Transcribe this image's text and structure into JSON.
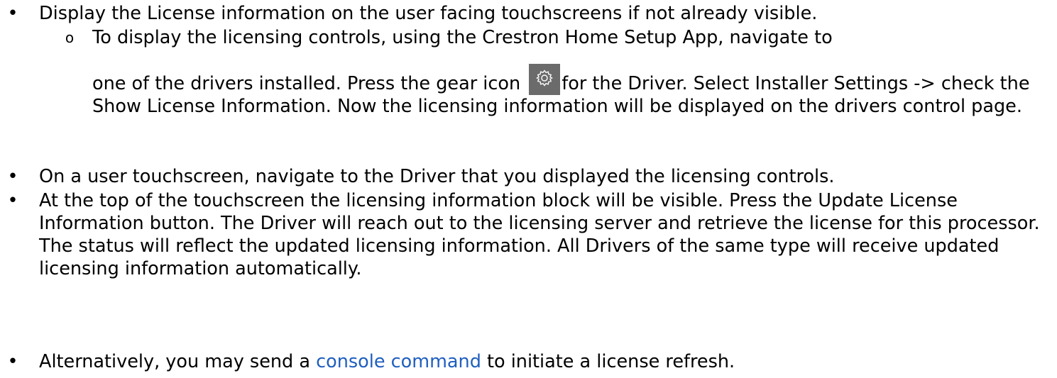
{
  "top_cutoff": "",
  "bullets": [
    {
      "text": "Display the License information on the user facing touchscreens if not already visible."
    },
    {
      "text": "On a user touchscreen, navigate to the Driver that you displayed the licensing controls."
    },
    {
      "text": "At the top of the touchscreen the licensing information block will be visible. Press the Update License Information button. The Driver will reach out to the licensing server and retrieve the license for this processor. The status will reflect the updated licensing information. All Drivers of the same type will receive updated licensing information automatically."
    },
    {
      "text_before": "Alternatively, you may send a ",
      "link": "console command",
      "text_after": " to initiate a license refresh."
    }
  ],
  "sub_bullet": {
    "line1": "To display the licensing controls, using the Crestron Home Setup App, navigate to",
    "before_icon": "one of the drivers installed. Press the gear icon",
    "after_icon": "for the Driver. Select Installer Settings -> check the Show License Information. Now the licensing information will be displayed on the drivers control page."
  },
  "icon": "gear-icon",
  "colors": {
    "link": "#1f5fbf",
    "gear_background": "#6b6b6b"
  }
}
